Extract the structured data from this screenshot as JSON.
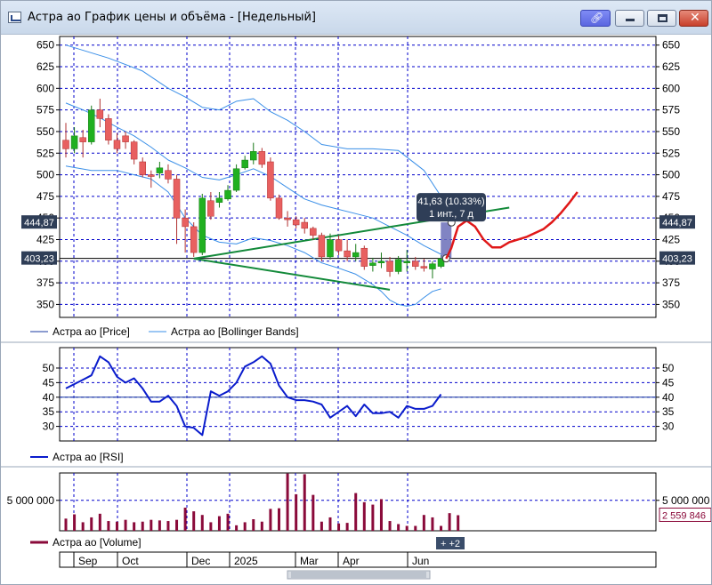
{
  "window": {
    "title": "Астра ао График цены и объёма - [Недельный]",
    "link_icon": "link-icon",
    "minimize_icon": "minimize-icon",
    "maximize_icon": "maximize-icon",
    "close_icon": "close-icon"
  },
  "chart_data": [
    {
      "type": "candlestick",
      "panel": "price",
      "ylim": [
        335,
        660
      ],
      "yticks": [
        350,
        375,
        400,
        425,
        450,
        475,
        500,
        525,
        550,
        575,
        600,
        625,
        650
      ],
      "grid": true,
      "colors": {
        "up": "#20b020",
        "down": "#e86060",
        "bollinger": "#3a8fe8",
        "trend": "#138a3a",
        "forecast": "#e01818"
      },
      "candles": [
        {
          "o": 540,
          "c": 530,
          "h": 560,
          "l": 520
        },
        {
          "o": 530,
          "c": 545,
          "h": 555,
          "l": 525
        },
        {
          "o": 543,
          "c": 538,
          "h": 552,
          "l": 520
        },
        {
          "o": 538,
          "c": 575,
          "h": 580,
          "l": 535
        },
        {
          "o": 575,
          "c": 565,
          "h": 588,
          "l": 555
        },
        {
          "o": 565,
          "c": 540,
          "h": 570,
          "l": 535
        },
        {
          "o": 540,
          "c": 530,
          "h": 548,
          "l": 525
        },
        {
          "o": 545,
          "c": 538,
          "h": 550,
          "l": 530
        },
        {
          "o": 538,
          "c": 518,
          "h": 540,
          "l": 512
        },
        {
          "o": 515,
          "c": 500,
          "h": 520,
          "l": 497
        },
        {
          "o": 500,
          "c": 498,
          "h": 505,
          "l": 485
        },
        {
          "o": 502,
          "c": 508,
          "h": 515,
          "l": 496
        },
        {
          "o": 505,
          "c": 495,
          "h": 512,
          "l": 490
        },
        {
          "o": 495,
          "c": 450,
          "h": 500,
          "l": 420
        },
        {
          "o": 450,
          "c": 440,
          "h": 460,
          "l": 410
        },
        {
          "o": 440,
          "c": 410,
          "h": 445,
          "l": 405
        },
        {
          "o": 410,
          "c": 473,
          "h": 478,
          "l": 407
        },
        {
          "o": 470,
          "c": 452,
          "h": 480,
          "l": 448
        },
        {
          "o": 468,
          "c": 473,
          "h": 480,
          "l": 462
        },
        {
          "o": 472,
          "c": 482,
          "h": 488,
          "l": 470
        },
        {
          "o": 482,
          "c": 507,
          "h": 512,
          "l": 480
        },
        {
          "o": 508,
          "c": 517,
          "h": 522,
          "l": 506
        },
        {
          "o": 517,
          "c": 527,
          "h": 537,
          "l": 512
        },
        {
          "o": 527,
          "c": 512,
          "h": 531,
          "l": 508
        },
        {
          "o": 515,
          "c": 473,
          "h": 520,
          "l": 470
        },
        {
          "o": 473,
          "c": 450,
          "h": 477,
          "l": 448
        },
        {
          "o": 450,
          "c": 448,
          "h": 458,
          "l": 440
        },
        {
          "o": 448,
          "c": 442,
          "h": 452,
          "l": 438
        },
        {
          "o": 445,
          "c": 438,
          "h": 450,
          "l": 432
        },
        {
          "o": 438,
          "c": 430,
          "h": 440,
          "l": 425
        },
        {
          "o": 430,
          "c": 405,
          "h": 433,
          "l": 400
        },
        {
          "o": 405,
          "c": 425,
          "h": 432,
          "l": 402
        },
        {
          "o": 425,
          "c": 412,
          "h": 430,
          "l": 407
        },
        {
          "o": 412,
          "c": 405,
          "h": 425,
          "l": 400
        },
        {
          "o": 405,
          "c": 410,
          "h": 420,
          "l": 400
        },
        {
          "o": 415,
          "c": 394,
          "h": 418,
          "l": 390
        },
        {
          "o": 395,
          "c": 398,
          "h": 404,
          "l": 388
        },
        {
          "o": 398,
          "c": 400,
          "h": 410,
          "l": 392
        },
        {
          "o": 400,
          "c": 388,
          "h": 405,
          "l": 382
        },
        {
          "o": 388,
          "c": 402,
          "h": 406,
          "l": 385
        },
        {
          "o": 398,
          "c": 400,
          "h": 413,
          "l": 388
        },
        {
          "o": 400,
          "c": 394,
          "h": 405,
          "l": 390
        },
        {
          "o": 394,
          "c": 392,
          "h": 403,
          "l": 388
        },
        {
          "o": 391,
          "c": 397,
          "h": 400,
          "l": 380
        },
        {
          "o": 394,
          "c": 403,
          "h": 407,
          "l": 392
        }
      ],
      "bollinger_upper": [
        [
          0,
          650
        ],
        [
          5,
          635
        ],
        [
          9,
          620
        ],
        [
          12,
          600
        ],
        [
          14,
          590
        ],
        [
          16,
          578
        ],
        [
          18,
          575
        ],
        [
          20,
          585
        ],
        [
          22,
          588
        ],
        [
          24,
          573
        ],
        [
          26,
          563
        ],
        [
          28,
          550
        ],
        [
          30,
          535
        ],
        [
          33,
          530
        ],
        [
          36,
          530
        ],
        [
          39,
          528
        ],
        [
          42,
          505
        ],
        [
          44,
          475
        ],
        [
          45.5,
          455
        ]
      ],
      "bollinger_lower": [
        [
          0,
          510
        ],
        [
          3,
          505
        ],
        [
          6,
          505
        ],
        [
          8,
          500
        ],
        [
          10,
          495
        ],
        [
          12,
          480
        ],
        [
          14,
          450
        ],
        [
          16,
          430
        ],
        [
          18,
          422
        ],
        [
          20,
          420
        ],
        [
          22,
          427
        ],
        [
          24,
          424
        ],
        [
          26,
          418
        ],
        [
          28,
          410
        ],
        [
          30,
          398
        ],
        [
          32,
          392
        ],
        [
          34,
          385
        ],
        [
          36,
          373
        ],
        [
          37,
          365
        ],
        [
          38,
          355
        ],
        [
          39,
          350
        ],
        [
          40,
          348
        ],
        [
          41,
          350
        ],
        [
          42,
          358
        ],
        [
          43,
          365
        ],
        [
          44,
          368
        ]
      ],
      "bollinger_middle": [
        [
          0,
          583
        ],
        [
          2,
          575
        ],
        [
          4,
          566
        ],
        [
          6,
          555
        ],
        [
          8,
          545
        ],
        [
          10,
          532
        ],
        [
          12,
          517
        ],
        [
          14,
          508
        ],
        [
          16,
          497
        ],
        [
          18,
          494
        ],
        [
          20,
          500
        ],
        [
          22,
          507
        ],
        [
          24,
          498
        ],
        [
          26,
          485
        ],
        [
          28,
          472
        ],
        [
          30,
          465
        ],
        [
          32,
          460
        ],
        [
          34,
          455
        ],
        [
          36,
          450
        ],
        [
          38,
          440
        ],
        [
          40,
          430
        ],
        [
          42,
          418
        ],
        [
          44,
          408
        ]
      ],
      "trend_upper": [
        [
          15,
          403
        ],
        [
          52,
          462
        ]
      ],
      "trend_lower": [
        [
          15,
          403
        ],
        [
          38,
          367
        ]
      ],
      "forecast": [
        [
          44.6,
          403
        ],
        [
          45.2,
          415
        ],
        [
          46,
          440
        ],
        [
          47,
          447
        ],
        [
          48,
          440
        ],
        [
          49,
          425
        ],
        [
          50,
          416
        ],
        [
          51,
          416
        ],
        [
          52,
          422
        ],
        [
          54,
          428
        ],
        [
          56,
          437
        ],
        [
          57,
          445
        ],
        [
          58,
          455
        ],
        [
          59,
          467
        ],
        [
          60,
          480
        ]
      ],
      "marker_top": 444.87,
      "marker_bottom": 403.23,
      "left_tags": [
        "444,87",
        "403,23"
      ],
      "right_tags": [
        "444,87",
        "403,23"
      ],
      "tooltip": [
        "41,63 (10.33%)",
        "1 инт., 7 д"
      ]
    },
    {
      "type": "line",
      "panel": "rsi",
      "ylim": [
        25,
        57
      ],
      "yticks": [
        30,
        35,
        40,
        45,
        50
      ],
      "reference_line": 40,
      "color": "#0a1ccc",
      "values": [
        [
          0,
          43
        ],
        [
          1,
          44.5
        ],
        [
          2,
          46
        ],
        [
          3,
          47.5
        ],
        [
          4,
          54
        ],
        [
          5,
          52
        ],
        [
          6,
          47
        ],
        [
          7,
          45
        ],
        [
          8,
          46.5
        ],
        [
          9,
          43
        ],
        [
          10,
          38.5
        ],
        [
          11,
          38.5
        ],
        [
          12,
          40.5
        ],
        [
          13,
          37
        ],
        [
          14,
          30
        ],
        [
          15,
          29.5
        ],
        [
          16,
          27
        ],
        [
          17,
          42
        ],
        [
          18,
          40.5
        ],
        [
          19,
          42
        ],
        [
          20,
          45
        ],
        [
          21,
          50.5
        ],
        [
          22,
          52
        ],
        [
          23,
          54
        ],
        [
          24,
          51.5
        ],
        [
          25,
          44
        ],
        [
          26,
          40
        ],
        [
          27,
          39
        ],
        [
          28,
          39
        ],
        [
          29,
          38.5
        ],
        [
          30,
          37.5
        ],
        [
          31,
          33
        ],
        [
          32,
          35
        ],
        [
          33,
          37
        ],
        [
          34,
          33.5
        ],
        [
          35,
          37.5
        ],
        [
          36,
          34.5
        ],
        [
          37,
          34.5
        ],
        [
          38,
          35
        ],
        [
          39,
          33
        ],
        [
          40,
          37
        ],
        [
          41,
          36
        ],
        [
          42,
          36
        ],
        [
          43,
          37
        ],
        [
          44,
          41
        ]
      ]
    },
    {
      "type": "bar",
      "panel": "volume",
      "ylim": [
        0,
        9500000
      ],
      "ytick_label": "5 000 000",
      "ytick_value": 5000000,
      "last_value_label": "2 559 846",
      "color": "#8a0a3a",
      "values": [
        2000000,
        2700000,
        1400000,
        2200000,
        2800000,
        1600000,
        1500000,
        1800000,
        1400000,
        1500000,
        1800000,
        1700000,
        1600000,
        1800000,
        3800000,
        3200000,
        2600000,
        1400000,
        2400000,
        2800000,
        900000,
        1400000,
        1900000,
        1500000,
        3600000,
        3700000,
        9400000,
        6000000,
        9300000,
        5900000,
        1500000,
        2200000,
        1200000,
        1300000,
        6200000,
        4700000,
        4300000,
        5200000,
        1600000,
        1100000,
        800000,
        800000,
        2600000,
        2200000,
        800000,
        2900000,
        2559846
      ]
    }
  ],
  "legend": {
    "price": "Астра ао [Price]",
    "bollinger": "Астра ао [Bollinger Bands]",
    "rsi": "Астра ао [RSI]",
    "volume": "Астра ао [Volume]"
  },
  "more_indicator": "+ +2",
  "x_axis": {
    "labels": [
      "Sep",
      "Oct",
      "Dec",
      "2025",
      "Mar",
      "Apr",
      "Jun"
    ],
    "label_positions": [
      1.3,
      5.8,
      14.2,
      19.3,
      26.4,
      30.9,
      38.7
    ]
  }
}
